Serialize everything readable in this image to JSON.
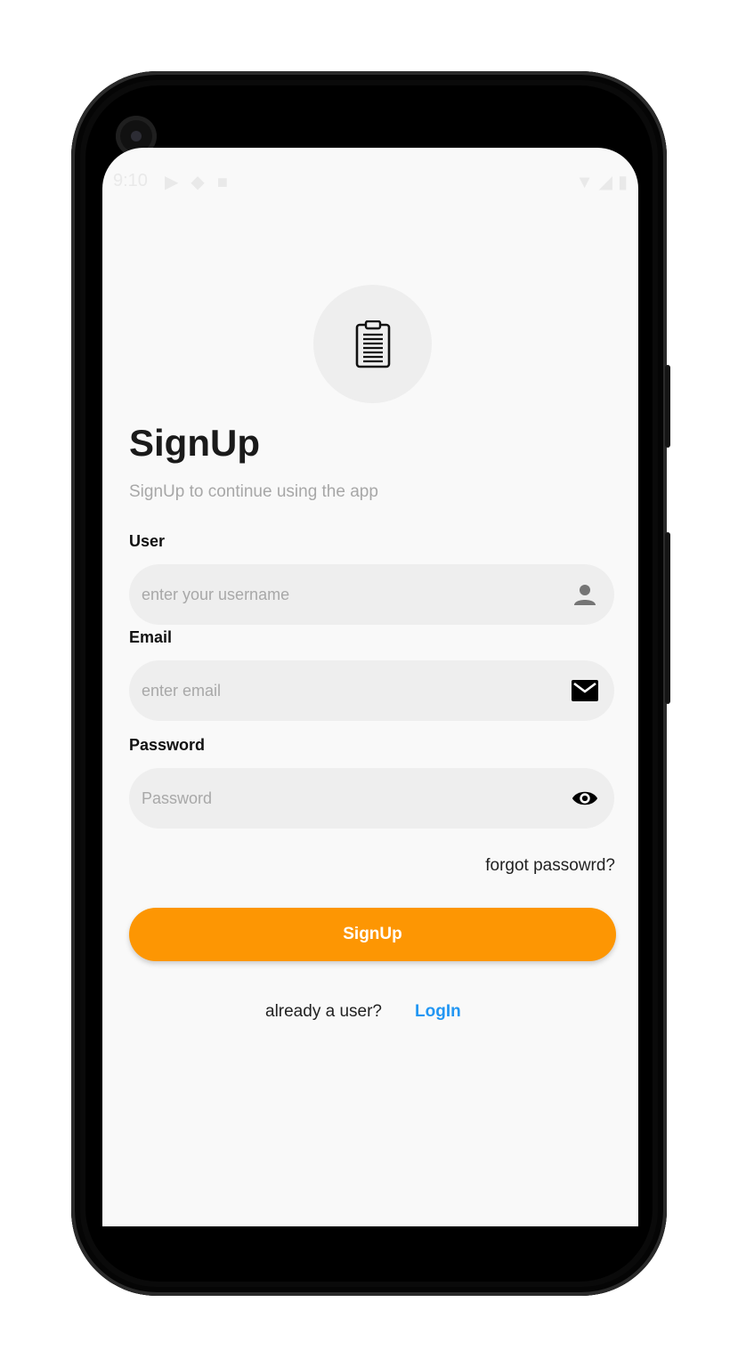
{
  "status_bar": {
    "time": "9:10",
    "left_icons": [
      "cast-icon",
      "shield-icon",
      "sd-card-icon"
    ],
    "right_icons": [
      "wifi-icon",
      "signal-icon",
      "battery-icon"
    ]
  },
  "header": {
    "logo_icon": "clipboard-icon",
    "title": "SignUp",
    "subtitle": "SignUp to continue using the app"
  },
  "form": {
    "user": {
      "label": "User",
      "placeholder": "enter your username",
      "icon": "person-icon"
    },
    "email": {
      "label": "Email",
      "placeholder": "enter email",
      "icon": "mail-icon"
    },
    "password": {
      "label": "Password",
      "placeholder": "Password",
      "icon": "eye-icon"
    },
    "forgot_label": "forgot passowrd?",
    "submit_label": "SignUp"
  },
  "footer": {
    "prompt": "already a user?",
    "login_label": "LogIn"
  },
  "colors": {
    "accent": "#fd9603",
    "link": "#2196f3",
    "field_bg": "#eeeeee",
    "screen_bg": "#f9f9f9"
  }
}
